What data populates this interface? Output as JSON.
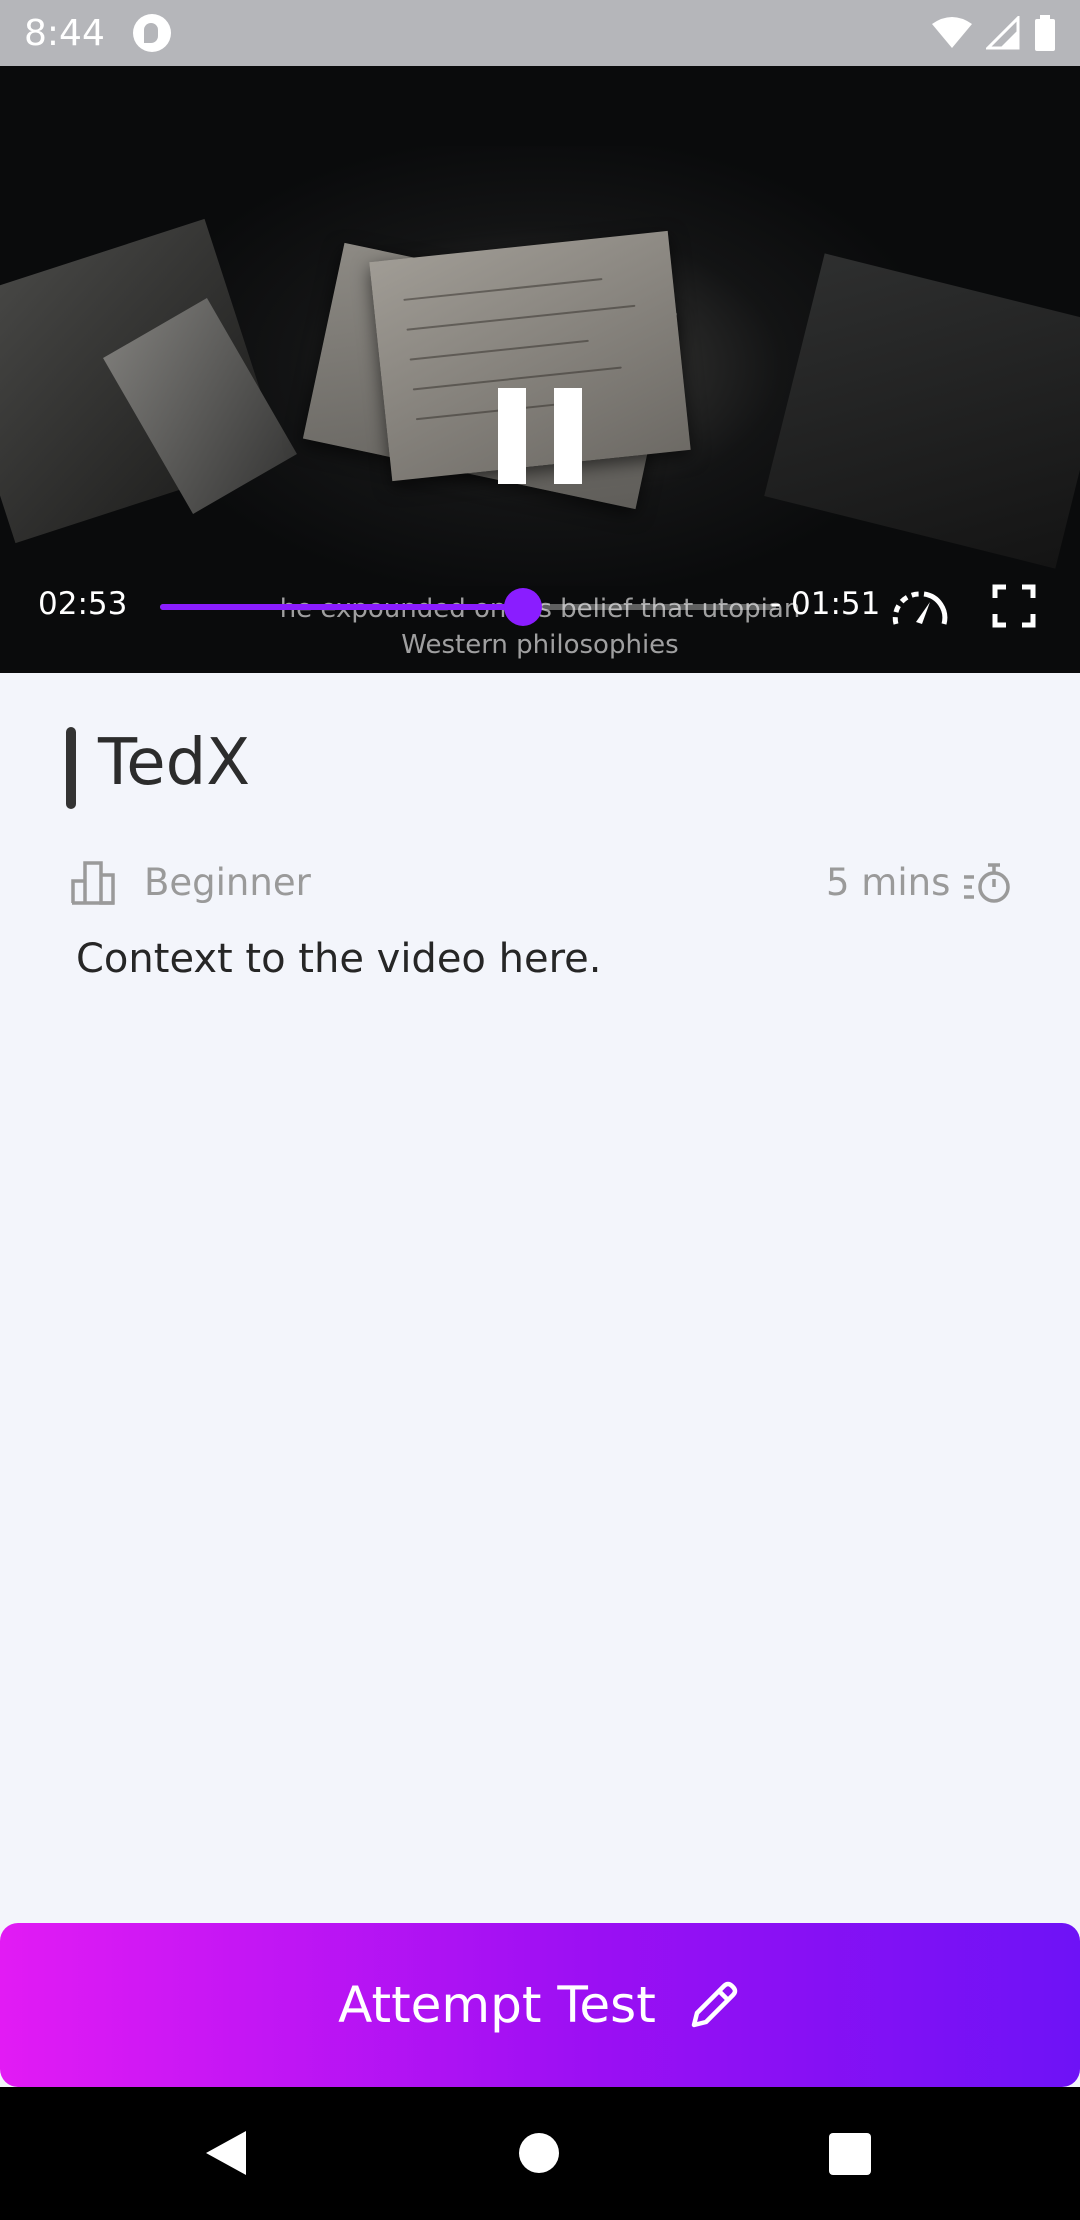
{
  "status_bar": {
    "time": "8:44",
    "icons": [
      "app-notification-icon",
      "wifi-icon",
      "cell-signal-icon",
      "battery-icon"
    ]
  },
  "video": {
    "elapsed": "02:53",
    "remaining": "- 01:51",
    "progress_fraction": 0.59,
    "subtitle_line1": "he expounded on his belief that utopian",
    "subtitle_line2": "Western philosophies",
    "accent_color": "#8a1dff"
  },
  "content": {
    "title": "TedX",
    "level": "Beginner",
    "duration": "5 mins",
    "description": "Context to the video here."
  },
  "cta": {
    "label": "Attempt Test",
    "gradient": [
      "#e21bf4",
      "#9b0ff3",
      "#6e12f6"
    ]
  }
}
